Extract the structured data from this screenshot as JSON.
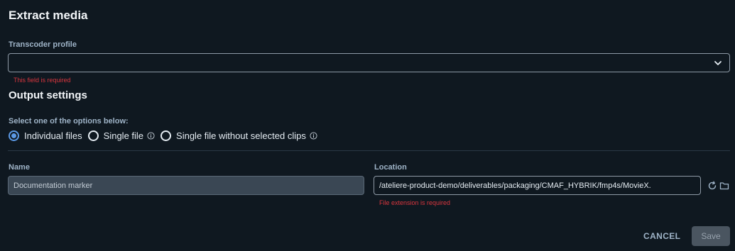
{
  "dialog": {
    "title": "Extract media"
  },
  "transcoder": {
    "label": "Transcoder profile",
    "value": "",
    "error": "This field is required",
    "icon": "chevron-down-icon"
  },
  "output": {
    "title": "Output settings",
    "prompt": "Select one of the options below:",
    "options": [
      {
        "label": "Individual files",
        "checked": true
      },
      {
        "label": "Single file",
        "checked": false,
        "info_icon": "info-icon"
      },
      {
        "label": "Single file without selected clips",
        "checked": false,
        "info_icon": "info-icon"
      }
    ]
  },
  "name": {
    "label": "Name",
    "value": "Documentation marker"
  },
  "location": {
    "label": "Location",
    "value": "/ateliere-product-demo/deliverables/packaging/CMAF_HYBRIK/fmp4s/MovieX.",
    "error": "File extension is required",
    "icons": [
      "refresh-icon",
      "folder-icon"
    ]
  },
  "actions": {
    "cancel_label": "CANCEL",
    "save_label": "Save"
  },
  "colors": {
    "background": "#0f1820",
    "accent": "#5c9ae6",
    "error": "#d9363e"
  }
}
